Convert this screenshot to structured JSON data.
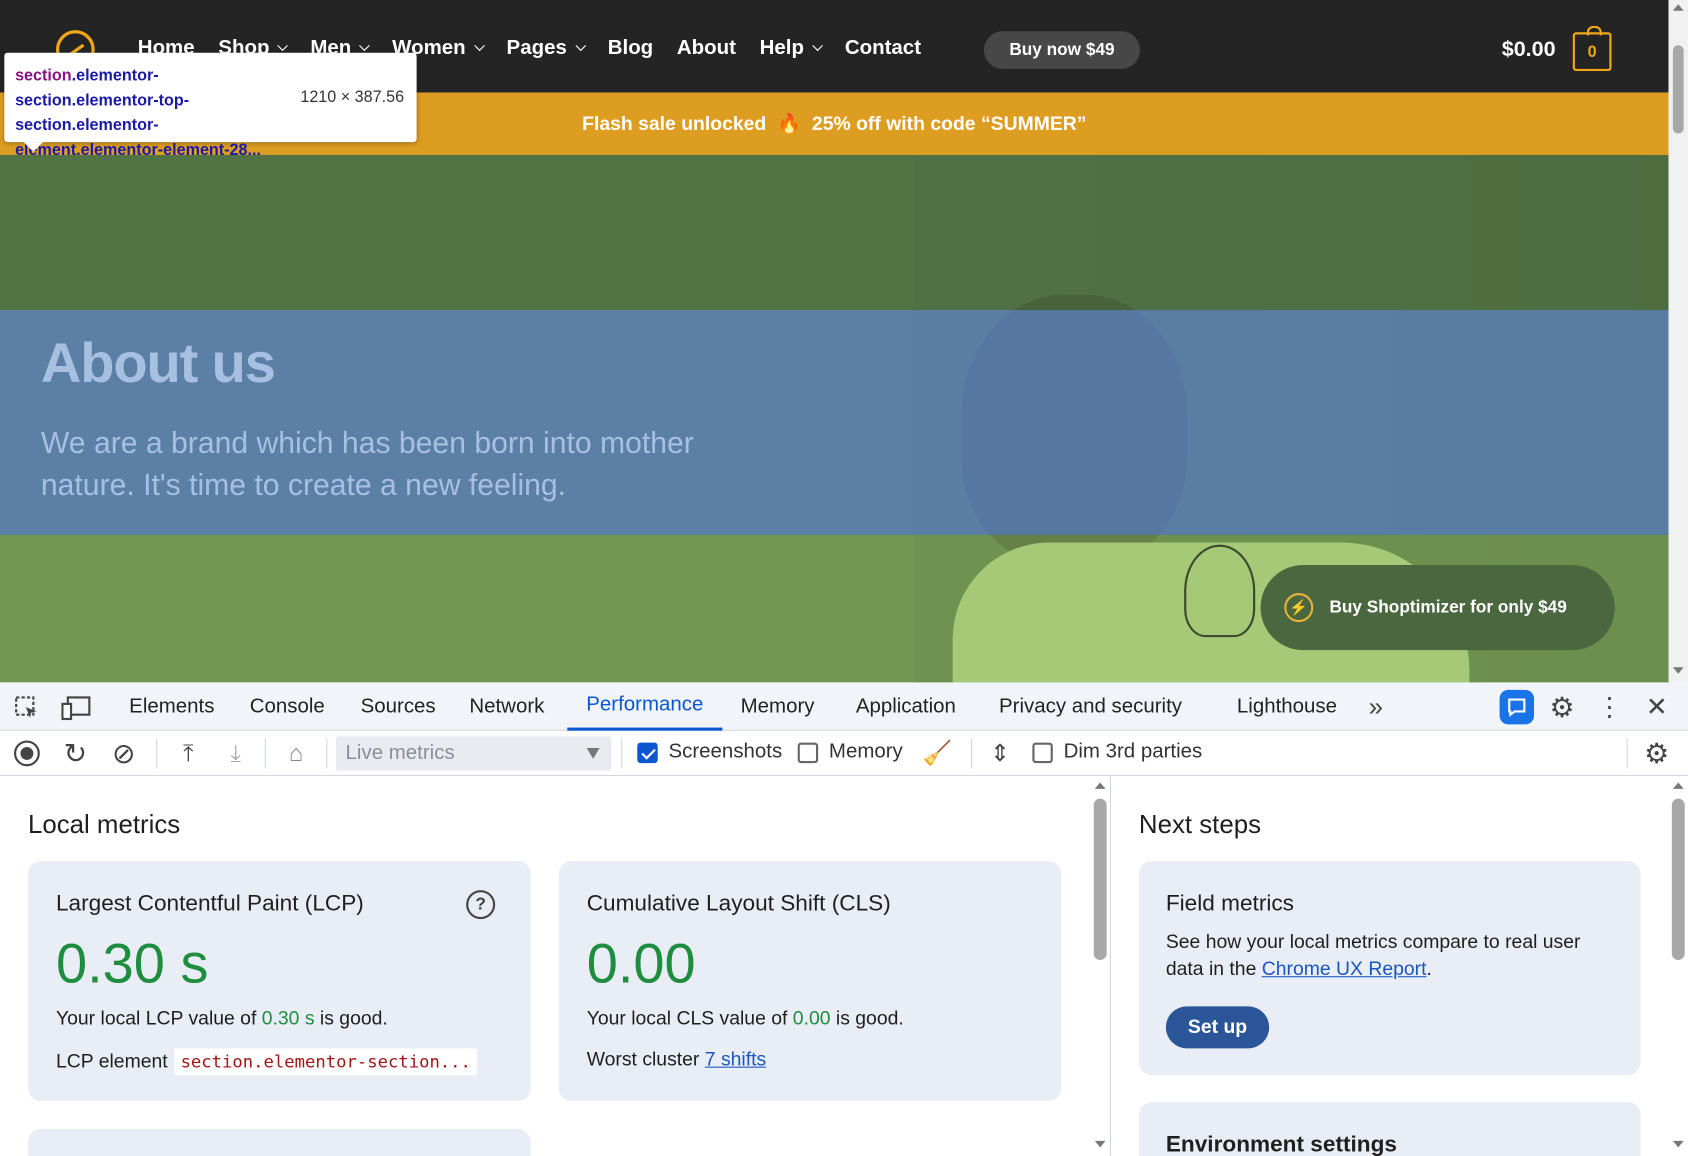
{
  "site": {
    "nav": [
      {
        "label": "Home",
        "dropdown": false
      },
      {
        "label": "Shop",
        "dropdown": true
      },
      {
        "label": "Men",
        "dropdown": true
      },
      {
        "label": "Women",
        "dropdown": true
      },
      {
        "label": "Pages",
        "dropdown": true
      },
      {
        "label": "Blog",
        "dropdown": false
      },
      {
        "label": "About",
        "dropdown": false
      },
      {
        "label": "Help",
        "dropdown": true
      },
      {
        "label": "Contact",
        "dropdown": false
      }
    ],
    "buy_button": "Buy now $49",
    "cart_total": "$0.00",
    "cart_count": "0",
    "sale_banner": {
      "left": "Flash sale unlocked",
      "icon": "🔥",
      "right": "25% off with code “SUMMER”"
    },
    "hero": {
      "title": "About us",
      "text": "We are a brand which has been born into mother nature. It's time to create a new feeling.",
      "cta": "Buy Shoptimizer for only $49"
    },
    "inspect_tooltip": {
      "selector_tag": "section",
      "selector_rest": ".elementor-section.elementor-top-section.elementor-element.elementor-element-28...",
      "dimensions": "1210 × 387.56"
    }
  },
  "devtools": {
    "tabs": [
      "Elements",
      "Console",
      "Sources",
      "Network",
      "Performance",
      "Memory",
      "Application",
      "Privacy and security",
      "Lighthouse"
    ],
    "active_tab": "Performance",
    "more_tabs": "»",
    "toolbar": {
      "mode_select": "Live metrics",
      "screenshots_label": "Screenshots",
      "screenshots_checked": true,
      "memory_label": "Memory",
      "memory_checked": false,
      "dim_label": "Dim 3rd parties",
      "dim_checked": false
    },
    "local_metrics": {
      "heading": "Local metrics",
      "lcp": {
        "title": "Largest Contentful Paint (LCP)",
        "value": "0.30 s",
        "desc_pre": "Your local LCP value of ",
        "desc_val": "0.30 s",
        "desc_post": " is good.",
        "element_label": "LCP element",
        "element_value": "section.elementor-section..."
      },
      "cls": {
        "title": "Cumulative Layout Shift (CLS)",
        "value": "0.00",
        "desc_pre": "Your local CLS value of ",
        "desc_val": "0.00",
        "desc_post": " is good.",
        "cluster_label": "Worst cluster",
        "cluster_link": "7 shifts"
      }
    },
    "next_steps": {
      "heading": "Next steps",
      "field": {
        "title": "Field metrics",
        "desc_pre": "See how your local metrics compare to real user data in the ",
        "desc_link": "Chrome UX Report",
        "desc_post": ".",
        "button": "Set up"
      },
      "env_title": "Environment settings"
    },
    "colors": {
      "accent": "#0b57d0",
      "good": "#1e8e3e",
      "sale": "#dd9d21",
      "brand": "#f0a818"
    }
  }
}
